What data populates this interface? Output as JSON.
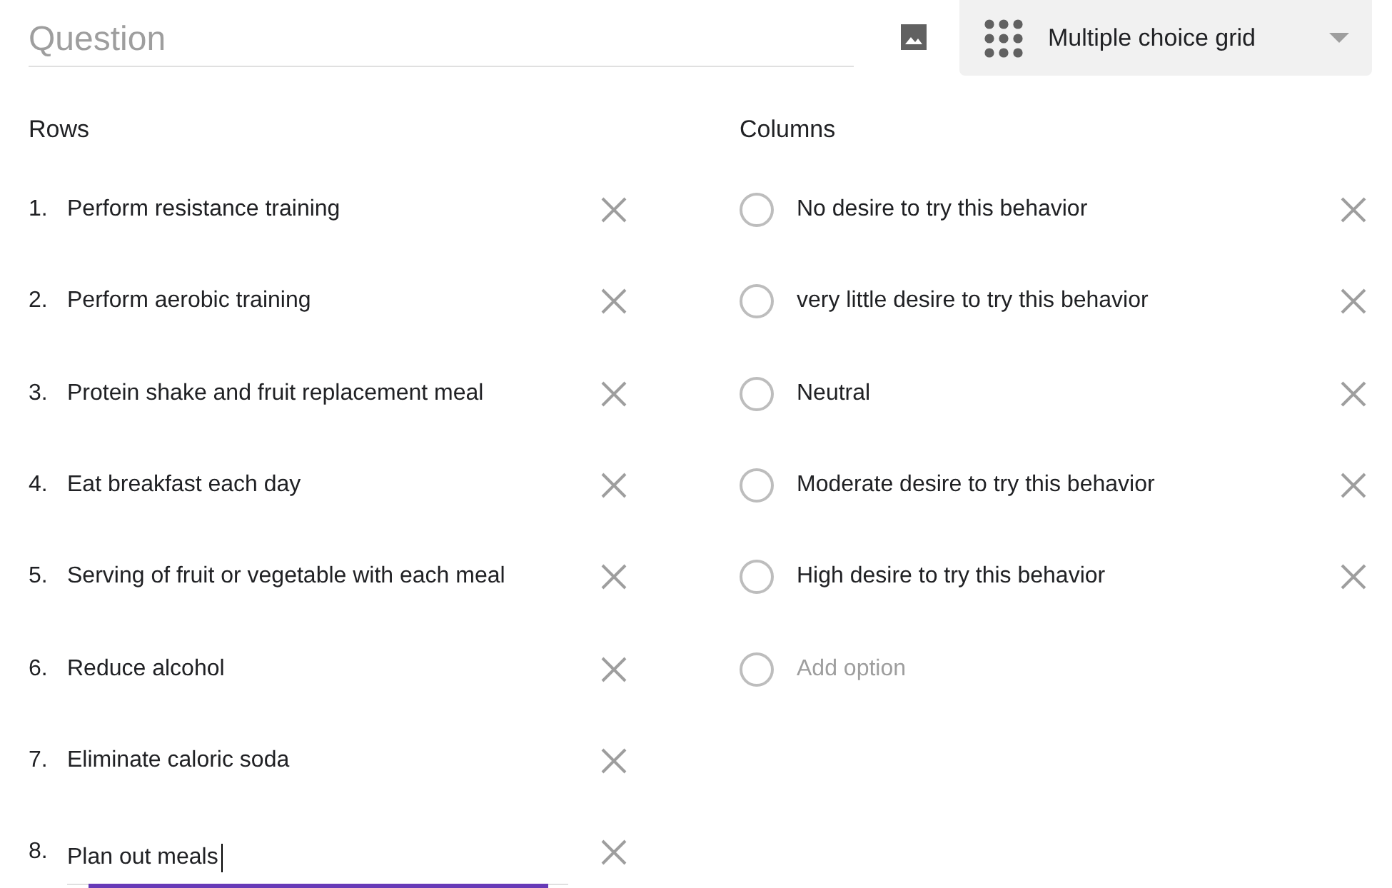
{
  "question": {
    "placeholder": "Question"
  },
  "question_type": {
    "label": "Multiple choice grid"
  },
  "rows": {
    "heading": "Rows",
    "items": [
      {
        "number": "1.",
        "text": "Perform resistance training",
        "focused": false
      },
      {
        "number": "2.",
        "text": "Perform aerobic training",
        "focused": false
      },
      {
        "number": "3.",
        "text": "Protein shake and fruit replacement meal",
        "focused": false
      },
      {
        "number": "4.",
        "text": "Eat breakfast each day",
        "focused": false
      },
      {
        "number": "5.",
        "text": "Serving of fruit or vegetable with each meal",
        "focused": false
      },
      {
        "number": "6.",
        "text": "Reduce alcohol",
        "focused": false
      },
      {
        "number": "7.",
        "text": "Eliminate caloric soda",
        "focused": false
      },
      {
        "number": "8.",
        "text": "Plan out meals",
        "focused": true
      }
    ]
  },
  "columns": {
    "heading": "Columns",
    "items": [
      {
        "kind": "option",
        "text": "No desire to try this behavior"
      },
      {
        "kind": "option",
        "text": "very little desire to try this behavior"
      },
      {
        "kind": "option",
        "text": "Neutral"
      },
      {
        "kind": "option",
        "text": "Moderate desire to try this behavior"
      },
      {
        "kind": "option",
        "text": "High desire to try this behavior"
      },
      {
        "kind": "add",
        "text": "Add option"
      }
    ]
  }
}
